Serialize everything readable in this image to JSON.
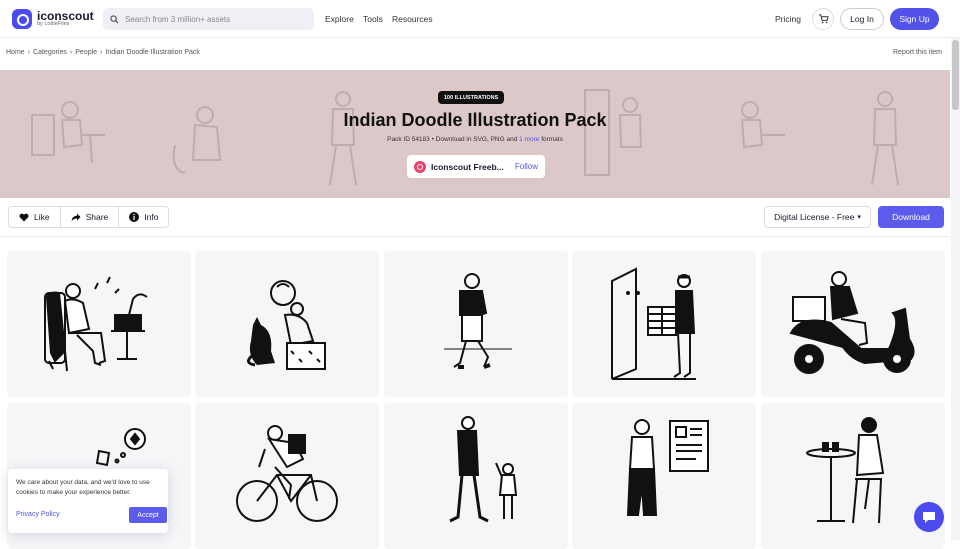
{
  "brand": {
    "name": "iconscout",
    "tagline": "by LottieFiles",
    "accent": "#5252ea"
  },
  "search": {
    "placeholder": "Search from 3 million+ assets",
    "icon": "search-icon"
  },
  "nav": {
    "explore": "Explore",
    "tools": "Tools",
    "resources": "Resources",
    "pricing": "Pricing",
    "login": "Log In",
    "signup": "Sign Up"
  },
  "breadcrumb": {
    "items": [
      "Home",
      "Categories",
      "People",
      "Indian Doodle Illustration Pack"
    ],
    "separator": "›",
    "report": "Report this item"
  },
  "hero": {
    "badge": "100 ILLUSTRATIONS",
    "title": "Indian Doodle Illustration Pack",
    "meta": "Pack ID 54183 •  Download in SVG, PNG and",
    "meta_link": "1 more",
    "meta_suffix": "formats",
    "author": "Iconscout Freeb...",
    "follow": "Follow",
    "background": "#ddc8c9"
  },
  "actions": {
    "like": "Like",
    "share": "Share",
    "info": "Info"
  },
  "license": {
    "label": "Digital License - Free",
    "icon": "chevron-down-icon"
  },
  "download": {
    "label": "Download"
  },
  "cards": [
    {
      "icon": "man-on-chair-with-gramophone"
    },
    {
      "icon": "person-with-cat-and-bag"
    },
    {
      "icon": "old-man-walking"
    },
    {
      "icon": "man-at-door-with-parcel"
    },
    {
      "icon": "man-riding-scooter"
    },
    {
      "icon": "thinking-person"
    },
    {
      "icon": "man-riding-bicycle"
    },
    {
      "icon": "father-and-child"
    },
    {
      "icon": "woman-with-document"
    },
    {
      "icon": "woman-at-cafe-table"
    }
  ],
  "cookie": {
    "text": "We care about your data, and we'd love to use cookies to make your experience better.",
    "link": "Privacy Policy",
    "accept": "Accept"
  }
}
